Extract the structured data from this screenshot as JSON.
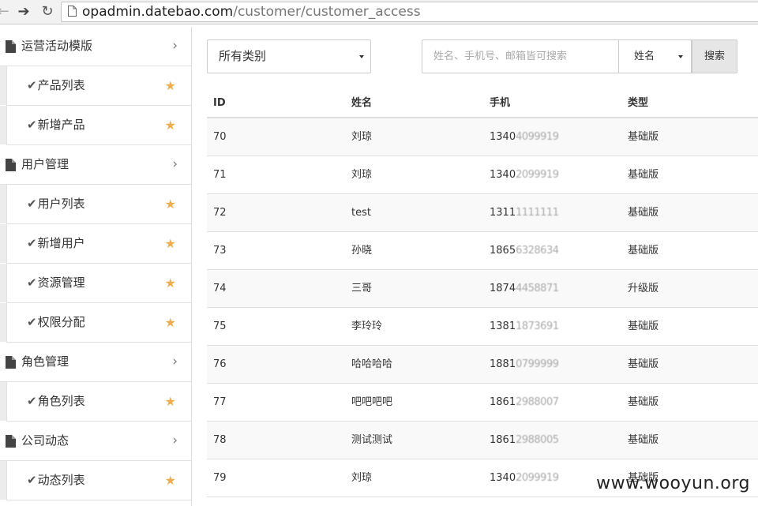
{
  "browser": {
    "url_domain": "opadmin.datebao.com",
    "url_path": "/customer/customer_access"
  },
  "sidebar": {
    "items": [
      {
        "kind": "group",
        "label": "运营活动模版",
        "name": "sidebar-group-campaign-templates"
      },
      {
        "kind": "sub",
        "label": "产品列表",
        "name": "sidebar-item-product-list"
      },
      {
        "kind": "sub",
        "label": "新增产品",
        "name": "sidebar-item-add-product"
      },
      {
        "kind": "group",
        "label": "用户管理",
        "name": "sidebar-group-user-management"
      },
      {
        "kind": "sub",
        "label": "用户列表",
        "name": "sidebar-item-user-list"
      },
      {
        "kind": "sub",
        "label": "新增用户",
        "name": "sidebar-item-add-user"
      },
      {
        "kind": "sub",
        "label": "资源管理",
        "name": "sidebar-item-resource-management"
      },
      {
        "kind": "sub",
        "label": "权限分配",
        "name": "sidebar-item-permission-assignment"
      },
      {
        "kind": "group",
        "label": "角色管理",
        "name": "sidebar-group-role-management"
      },
      {
        "kind": "sub",
        "label": "角色列表",
        "name": "sidebar-item-role-list"
      },
      {
        "kind": "group",
        "label": "公司动态",
        "name": "sidebar-group-company-news"
      },
      {
        "kind": "sub",
        "label": "动态列表",
        "name": "sidebar-item-news-list"
      }
    ]
  },
  "filters": {
    "category_value": "所有类别",
    "search_placeholder": "姓名、手机号、邮箱皆可搜索",
    "field_value": "姓名",
    "search_label": "搜索"
  },
  "table": {
    "headers": {
      "id": "ID",
      "name": "姓名",
      "phone": "手机",
      "type": "类型"
    },
    "rows": [
      {
        "id": "70",
        "name": "刘琼",
        "phone_prefix": "1340",
        "phone_masked": "4099919",
        "type": "基础版"
      },
      {
        "id": "71",
        "name": "刘琼",
        "phone_prefix": "1340",
        "phone_masked": "2099919",
        "type": "基础版"
      },
      {
        "id": "72",
        "name": "test",
        "phone_prefix": "1311",
        "phone_masked": "1111111",
        "type": "基础版"
      },
      {
        "id": "73",
        "name": "孙晓",
        "phone_prefix": "1865",
        "phone_masked": "6328634",
        "type": "基础版"
      },
      {
        "id": "74",
        "name": "三哥",
        "phone_prefix": "1874",
        "phone_masked": "4458871",
        "type": "升级版"
      },
      {
        "id": "75",
        "name": "李玲玲",
        "phone_prefix": "1381",
        "phone_masked": "1873691",
        "type": "基础版"
      },
      {
        "id": "76",
        "name": "哈哈哈哈",
        "phone_prefix": "1881",
        "phone_masked": "0799999",
        "type": "基础版"
      },
      {
        "id": "77",
        "name": "吧吧吧吧",
        "phone_prefix": "1861",
        "phone_masked": "2988007",
        "type": "基础版"
      },
      {
        "id": "78",
        "name": "测试测试",
        "phone_prefix": "1861",
        "phone_masked": "2988005",
        "type": "基础版"
      },
      {
        "id": "79",
        "name": "刘琼",
        "phone_prefix": "1340",
        "phone_masked": "2099919",
        "type": "基础版"
      }
    ]
  },
  "watermark": "www.wooyun.org",
  "colors": {
    "star": "#f0ad4e",
    "stripe": "#f9f9f9",
    "border": "#dddddd"
  }
}
